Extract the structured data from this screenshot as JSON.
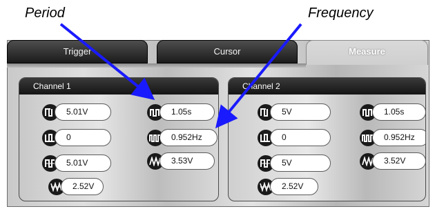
{
  "annotations": {
    "period": "Period",
    "frequency": "Frequency"
  },
  "tabs": {
    "trigger": "Trigger",
    "cursor": "Cursor",
    "measure": "Measure"
  },
  "channels": [
    {
      "title": "Channel 1",
      "measurements": [
        {
          "icon": "positive-peak-voltage-icon",
          "value": "5.01V"
        },
        {
          "icon": "period-icon",
          "value": "1.05s"
        },
        {
          "icon": "minimum-voltage-icon",
          "value": "0"
        },
        {
          "icon": "frequency-icon",
          "value": "0.952Hz"
        },
        {
          "icon": "maximum-voltage-icon",
          "value": "5.01V"
        },
        {
          "icon": "peak-to-peak-voltage-icon",
          "value": "3.53V"
        },
        {
          "icon": "mean-voltage-icon",
          "value": "2.52V"
        }
      ]
    },
    {
      "title": "Channel 2",
      "measurements": [
        {
          "icon": "positive-peak-voltage-icon",
          "value": "5V"
        },
        {
          "icon": "period-icon",
          "value": "1.05s"
        },
        {
          "icon": "minimum-voltage-icon",
          "value": "0"
        },
        {
          "icon": "frequency-icon",
          "value": "0.952Hz"
        },
        {
          "icon": "maximum-voltage-icon",
          "value": "5V"
        },
        {
          "icon": "peak-to-peak-voltage-icon",
          "value": "3.52V"
        },
        {
          "icon": "mean-voltage-icon",
          "value": "2.52V"
        }
      ]
    }
  ]
}
